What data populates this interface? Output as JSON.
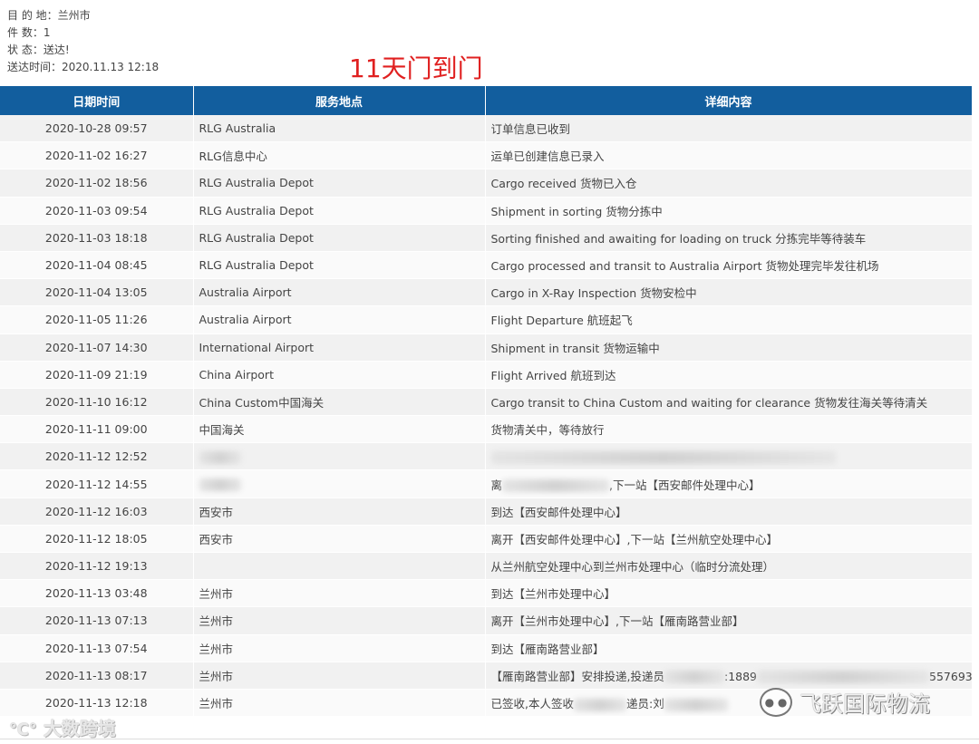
{
  "summary": {
    "destination": "目 的 地：兰州市",
    "pieces": "件 数：1",
    "status": "状 态：送达!",
    "delivered_time": "送达时间：2020.11.13 12:18"
  },
  "headline": "11天门到门",
  "table": {
    "headers": [
      "日期时间",
      "服务地点",
      "详细内容"
    ],
    "rows": [
      {
        "time": "2020-10-28 09:57",
        "place": "RLG Australia",
        "detail": "订单信息已收到"
      },
      {
        "time": "2020-11-02 16:27",
        "place": "RLG信息中心",
        "detail": "运单已创建信息已录入"
      },
      {
        "time": "2020-11-02 18:56",
        "place": "RLG Australia Depot",
        "detail": "Cargo received 货物已入仓"
      },
      {
        "time": "2020-11-03 09:54",
        "place": "RLG Australia Depot",
        "detail": "Shipment in sorting 货物分拣中"
      },
      {
        "time": "2020-11-03 18:18",
        "place": "RLG Australia Depot",
        "detail": "Sorting finished and awaiting for loading on truck 分拣完毕等待装车"
      },
      {
        "time": "2020-11-04 08:45",
        "place": "RLG Australia Depot",
        "detail": "Cargo processed and transit to Australia Airport 货物处理完毕发往机场"
      },
      {
        "time": "2020-11-04 13:05",
        "place": "Australia Airport",
        "detail": "Cargo in X-Ray Inspection 货物安检中"
      },
      {
        "time": "2020-11-05 11:26",
        "place": "Australia Airport",
        "detail": "Flight Departure 航班起飞"
      },
      {
        "time": "2020-11-07 14:30",
        "place": "International Airport",
        "detail": "Shipment in transit 货物运输中"
      },
      {
        "time": "2020-11-09 21:19",
        "place": "China Airport",
        "detail": "Flight Arrived 航班到达"
      },
      {
        "time": "2020-11-10 16:12",
        "place": "China Custom中国海关",
        "detail": "Cargo transit to China Custom and waiting for clearance 货物发往海关等待清关"
      },
      {
        "time": "2020-11-11 09:00",
        "place": "中国海关",
        "detail": "货物清关中，等待放行"
      },
      {
        "time": "2020-11-12 12:52",
        "place": "",
        "detail": ""
      },
      {
        "time": "2020-11-12 14:55",
        "place": "",
        "detail": "离",
        "detail_tail": ",下一站【西安邮件处理中心】"
      },
      {
        "time": "2020-11-12 16:03",
        "place": "西安市",
        "detail": "到达【西安邮件处理中心】"
      },
      {
        "time": "2020-11-12 18:05",
        "place": "西安市",
        "detail": "离开【西安邮件处理中心】,下一站【兰州航空处理中心】"
      },
      {
        "time": "2020-11-12 19:13",
        "place": "",
        "detail": "从兰州航空处理中心到兰州市处理中心（临时分流处理）"
      },
      {
        "time": "2020-11-13 03:48",
        "place": "兰州市",
        "detail": "到达【兰州市处理中心】"
      },
      {
        "time": "2020-11-13 07:13",
        "place": "兰州市",
        "detail": "离开【兰州市处理中心】,下一站【雁南路营业部】"
      },
      {
        "time": "2020-11-13 07:54",
        "place": "兰州市",
        "detail": "到达【雁南路营业部】"
      },
      {
        "time": "2020-11-13 08:17",
        "place": "兰州市",
        "detail": "【雁南路营业部】安排投递,投递员",
        "detail_mid": ":1889",
        "detail_tail": "557693"
      },
      {
        "time": "2020-11-13 12:18",
        "place": "兰州市",
        "detail": "已签收,本人签收",
        "detail_mid": "递员:刘",
        "detail_tail": ""
      }
    ]
  },
  "watermark_left": "大数跨境",
  "watermark_right": "飞跃国际物流",
  "colors": {
    "header_bg": "#125e9e",
    "headline": "#e02020"
  }
}
